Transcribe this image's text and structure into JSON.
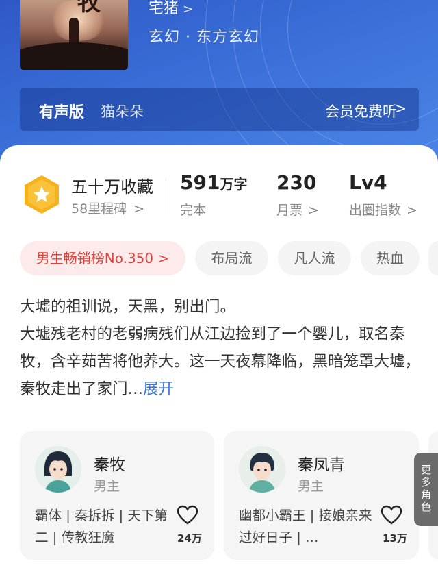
{
  "book": {
    "author": "宅猪",
    "genre_main": "玄幻",
    "genre_sub": "东方玄幻",
    "genre_sep": "·"
  },
  "audio": {
    "label": "有声版",
    "narrator": "猫朵朵",
    "action": "会员免费听"
  },
  "stats": {
    "collect_title": "五十万收藏",
    "collect_sub": "58里程碑",
    "words_value": "591",
    "words_unit": "万字",
    "words_sub": "完本",
    "tickets_value": "230",
    "tickets_sub": "月票",
    "level_value": "Lv4",
    "level_sub": "出圈指数"
  },
  "tags": [
    "男生畅销榜No.350 >",
    "布局流",
    "凡人流",
    "热血"
  ],
  "description": {
    "text": "大墟的祖训说，天黑，别出门。\n大墟残老村的老弱病残们从江边捡到了一个婴儿，取名秦牧，含辛茹苦将他养大。这一天夜幕降临，黑暗笼罩大墟，秦牧走出了家门…",
    "expand": "展开"
  },
  "characters": [
    {
      "name": "秦牧",
      "role": "男主",
      "tags": "霸体 | 秦拆拆 | 天下第二 | 传教狂魔",
      "likes": "24万"
    },
    {
      "name": "秦凤青",
      "role": "男主",
      "tags": "幽都小霸王 | 接娘亲来过好日子 | …",
      "likes": "13万"
    }
  ],
  "more_characters": "更多角色",
  "colors": {
    "hero": "#3a6fd8",
    "accent_red": "#e0443e",
    "link_blue": "#3a78d8",
    "badge": "#f6b21a"
  }
}
